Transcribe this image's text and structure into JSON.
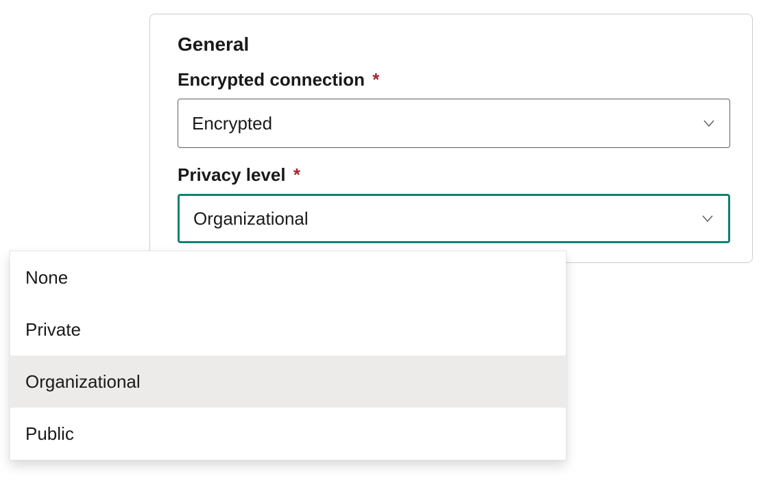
{
  "panel": {
    "title": "General",
    "encrypted": {
      "label": "Encrypted connection",
      "required": "*",
      "value": "Encrypted"
    },
    "privacy": {
      "label": "Privacy level",
      "required": "*",
      "value": "Organizational"
    }
  },
  "menu": {
    "items": [
      "None",
      "Private",
      "Organizational",
      "Public"
    ],
    "selected_index": 2
  }
}
